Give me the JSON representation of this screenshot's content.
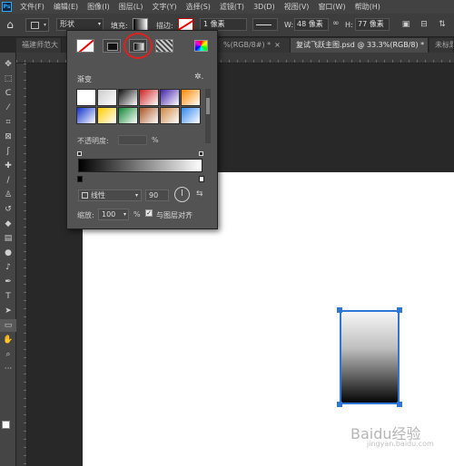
{
  "app": {
    "logo": "Ps"
  },
  "menu": [
    "文件(F)",
    "编辑(E)",
    "图像(I)",
    "图层(L)",
    "文字(Y)",
    "选择(S)",
    "滤镜(T)",
    "3D(D)",
    "视图(V)",
    "窗口(W)",
    "帮助(H)"
  ],
  "options": {
    "home_icon": "home-icon",
    "mode": "形状",
    "fill_label": "填充:",
    "stroke_label": "描边:",
    "stroke_width": "1 像素",
    "w_label": "W:",
    "w_value": "48 像素",
    "h_label": "H:",
    "h_value": "77 像素"
  },
  "tabs": [
    {
      "label": "福建师范大",
      "close": ""
    },
    {
      "label": "%(RGB/8#) *",
      "close": "×"
    },
    {
      "label": "复试飞跃主图.psd @ 33.3%(RGB/8) *",
      "close": "×"
    },
    {
      "label": "未标题",
      "close": ""
    }
  ],
  "popup": {
    "gradient_title": "渐变",
    "gear": "✲.",
    "opacity_label": "不透明度:",
    "opacity_unit": "%",
    "style_value": "线性",
    "angle_value": "90",
    "scale_label": "缩放:",
    "scale_value": "100",
    "scale_unit": "%",
    "align_label": "与图层对齐",
    "align_checked": true,
    "preset_colors": [
      "#ffffff",
      "#cccccc",
      "#111111",
      "#cc2222",
      "#4422aa",
      "#ff8800",
      "#1133cc",
      "#ffcc00",
      "#118833",
      "#aa5522",
      "#cc8844",
      "#3388ee"
    ]
  },
  "canvas": {
    "background": "#ffffff",
    "shape_selection_color": "#2e76d6"
  },
  "watermark": {
    "brand": "Baidu经验",
    "sub": "jingyan.baidu.com"
  }
}
